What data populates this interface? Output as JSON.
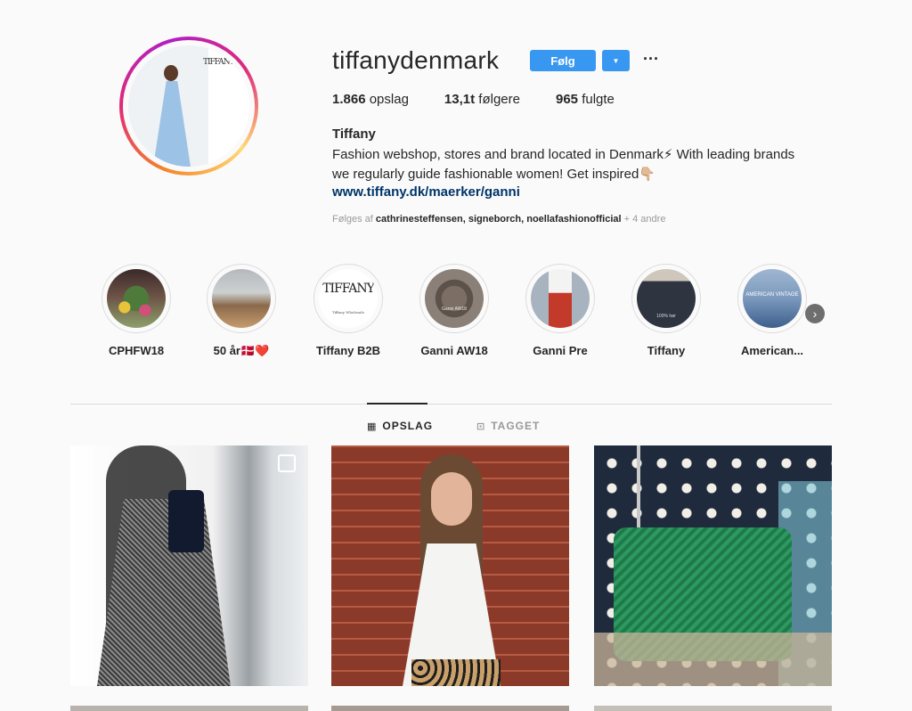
{
  "profile": {
    "username": "tiffanydenmark",
    "follow_label": "Følg",
    "dropdown_icon": "▼",
    "more_icon": "···",
    "stats": [
      {
        "count": "1.866",
        "label": "opslag"
      },
      {
        "count": "13,1t",
        "label": "følgere"
      },
      {
        "count": "965",
        "label": "fulgte"
      }
    ],
    "full_name": "Tiffany",
    "bio_line1": "Fashion webshop, stores and brand located in Denmark⚡  With leading brands",
    "bio_line2": "we regularly guide fashionable women! Get inspired👇🏼",
    "website": "www.tiffany.dk/maerker/ganni",
    "followed_by_prefix": "Følges af",
    "followed_by_names": "cathrinesteffensen, signeborch, noellafashionofficial",
    "followed_by_suffix": "+ 4 andre",
    "avatar_logo_text": "TIFFANY"
  },
  "highlights": [
    {
      "label": "CPHFW18"
    },
    {
      "label": "50 år🇩🇰❤️"
    },
    {
      "label": "Tiffany B2B",
      "logo": "TIFFANY",
      "sub": "Tiffany Wholesale"
    },
    {
      "label": "Ganni AW18",
      "sub": "Ganni AW18"
    },
    {
      "label": "Ganni Pre"
    },
    {
      "label": "Tiffany",
      "sub": "100% hør"
    },
    {
      "label": "American...",
      "sub": "AMERICAN VINTAGE"
    }
  ],
  "highlights_next_icon": "›",
  "tabs": [
    {
      "label": "OPSLAG",
      "icon": "grid-icon",
      "glyph": "▦"
    },
    {
      "label": "TAGGET",
      "icon": "tagged-icon",
      "glyph": "⊡"
    }
  ],
  "colors": {
    "accent": "#3897f0",
    "link": "#003569",
    "ring_start": "#f58529",
    "ring_mid": "#dd2a7b"
  }
}
